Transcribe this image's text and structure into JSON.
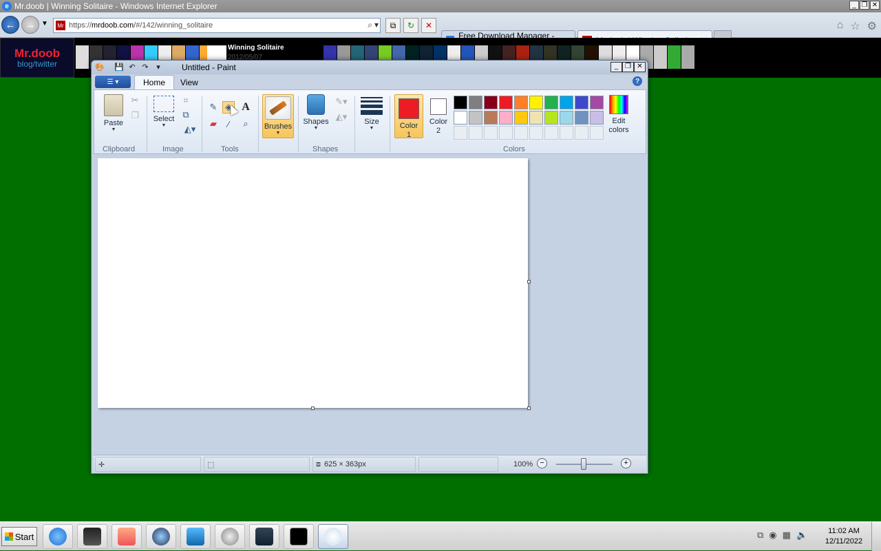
{
  "ie": {
    "window_title": "Mr.doob | Winning Solitaire - Windows Internet Explorer",
    "controls": [
      "_",
      "❐",
      "✕"
    ],
    "address_scheme": "https://",
    "address_host": "mrdoob.com",
    "address_path": "/#/142/winning_solitaire",
    "address_fav": "Mr",
    "tabs": [
      {
        "label": "Free Download Manager - absolu...",
        "icon": "fdm-icon",
        "active": false
      },
      {
        "label": "Mr.doob | Winning Solitaire",
        "icon": "mrdoob-icon",
        "active": true
      }
    ],
    "tab_close": "✕"
  },
  "site": {
    "logo_line1": "Mr.doob",
    "logo_line2": "blog/twitter",
    "featured_title": "Winning Solitaire",
    "featured_date": "2012/05/07"
  },
  "paint": {
    "title": "Untitled - Paint",
    "tabs": [
      "Home",
      "View"
    ],
    "active_tab": "Home",
    "clipboard": {
      "paste": "Paste",
      "group": "Clipboard"
    },
    "image": {
      "select": "Select",
      "group": "Image"
    },
    "tools": {
      "group": "Tools"
    },
    "brushes": "Brushes",
    "shapes": {
      "label": "Shapes",
      "group": "Shapes"
    },
    "size": "Size",
    "color1": {
      "line1": "Color",
      "line2": "1",
      "value": "#ed1c24"
    },
    "color2": {
      "line1": "Color",
      "line2": "2",
      "value": "#ffffff"
    },
    "colors_group": "Colors",
    "edit_colors": {
      "line1": "Edit",
      "line2": "colors"
    },
    "palette_row1": [
      "#000000",
      "#7f7f7f",
      "#880015",
      "#ed1c24",
      "#ff7f27",
      "#fff200",
      "#22b14c",
      "#00a2e8",
      "#3f48cc",
      "#a349a4"
    ],
    "palette_row2": [
      "#ffffff",
      "#c3c3c3",
      "#b97a57",
      "#ffaec9",
      "#ffc90e",
      "#efe4b0",
      "#b5e61d",
      "#99d9ea",
      "#7092be",
      "#c8bfe7"
    ],
    "status": {
      "dimensions": "625 × 363px",
      "zoom": "100%"
    }
  },
  "taskbar": {
    "start": "Start",
    "apps": [
      "ie-icon",
      "media-center-icon",
      "media-player-icon",
      "network-icon",
      "remote-desktop-icon",
      "dvd-icon",
      "game-icon",
      "cmd-icon",
      "paint-icon"
    ],
    "time": "11:02 AM",
    "date": "12/11/2022"
  }
}
